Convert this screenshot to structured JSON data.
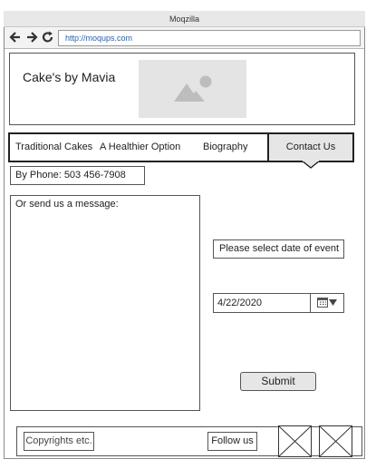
{
  "browser": {
    "title": "Moqzilla",
    "url": "http://moqups.com",
    "icons": [
      "back-arrow-icon",
      "forward-arrow-icon",
      "reload-icon"
    ]
  },
  "header": {
    "brand": "Cake's by Mavia",
    "logo_icon": "image-placeholder-icon"
  },
  "menu": {
    "items": [
      "Traditional Cakes",
      "A Healthier Option",
      "Biography"
    ],
    "active": "Contact Us"
  },
  "contact": {
    "phone": "By Phone: 503 456-7908",
    "message_placeholder": "Or send us a message:",
    "date_label": "Please select date of event",
    "date_value": "4/22/2020",
    "submit": "Submit"
  },
  "footer": {
    "copyright": "Copyrights etc.",
    "follow": "Follow us",
    "social_icons": [
      "image-placeholder-icon",
      "image-placeholder-icon"
    ]
  },
  "colors": {
    "url_text": "#2d5ea8",
    "placeholder_bg": "#e4e4e4",
    "active_tab_bg": "#e6e6e6"
  }
}
